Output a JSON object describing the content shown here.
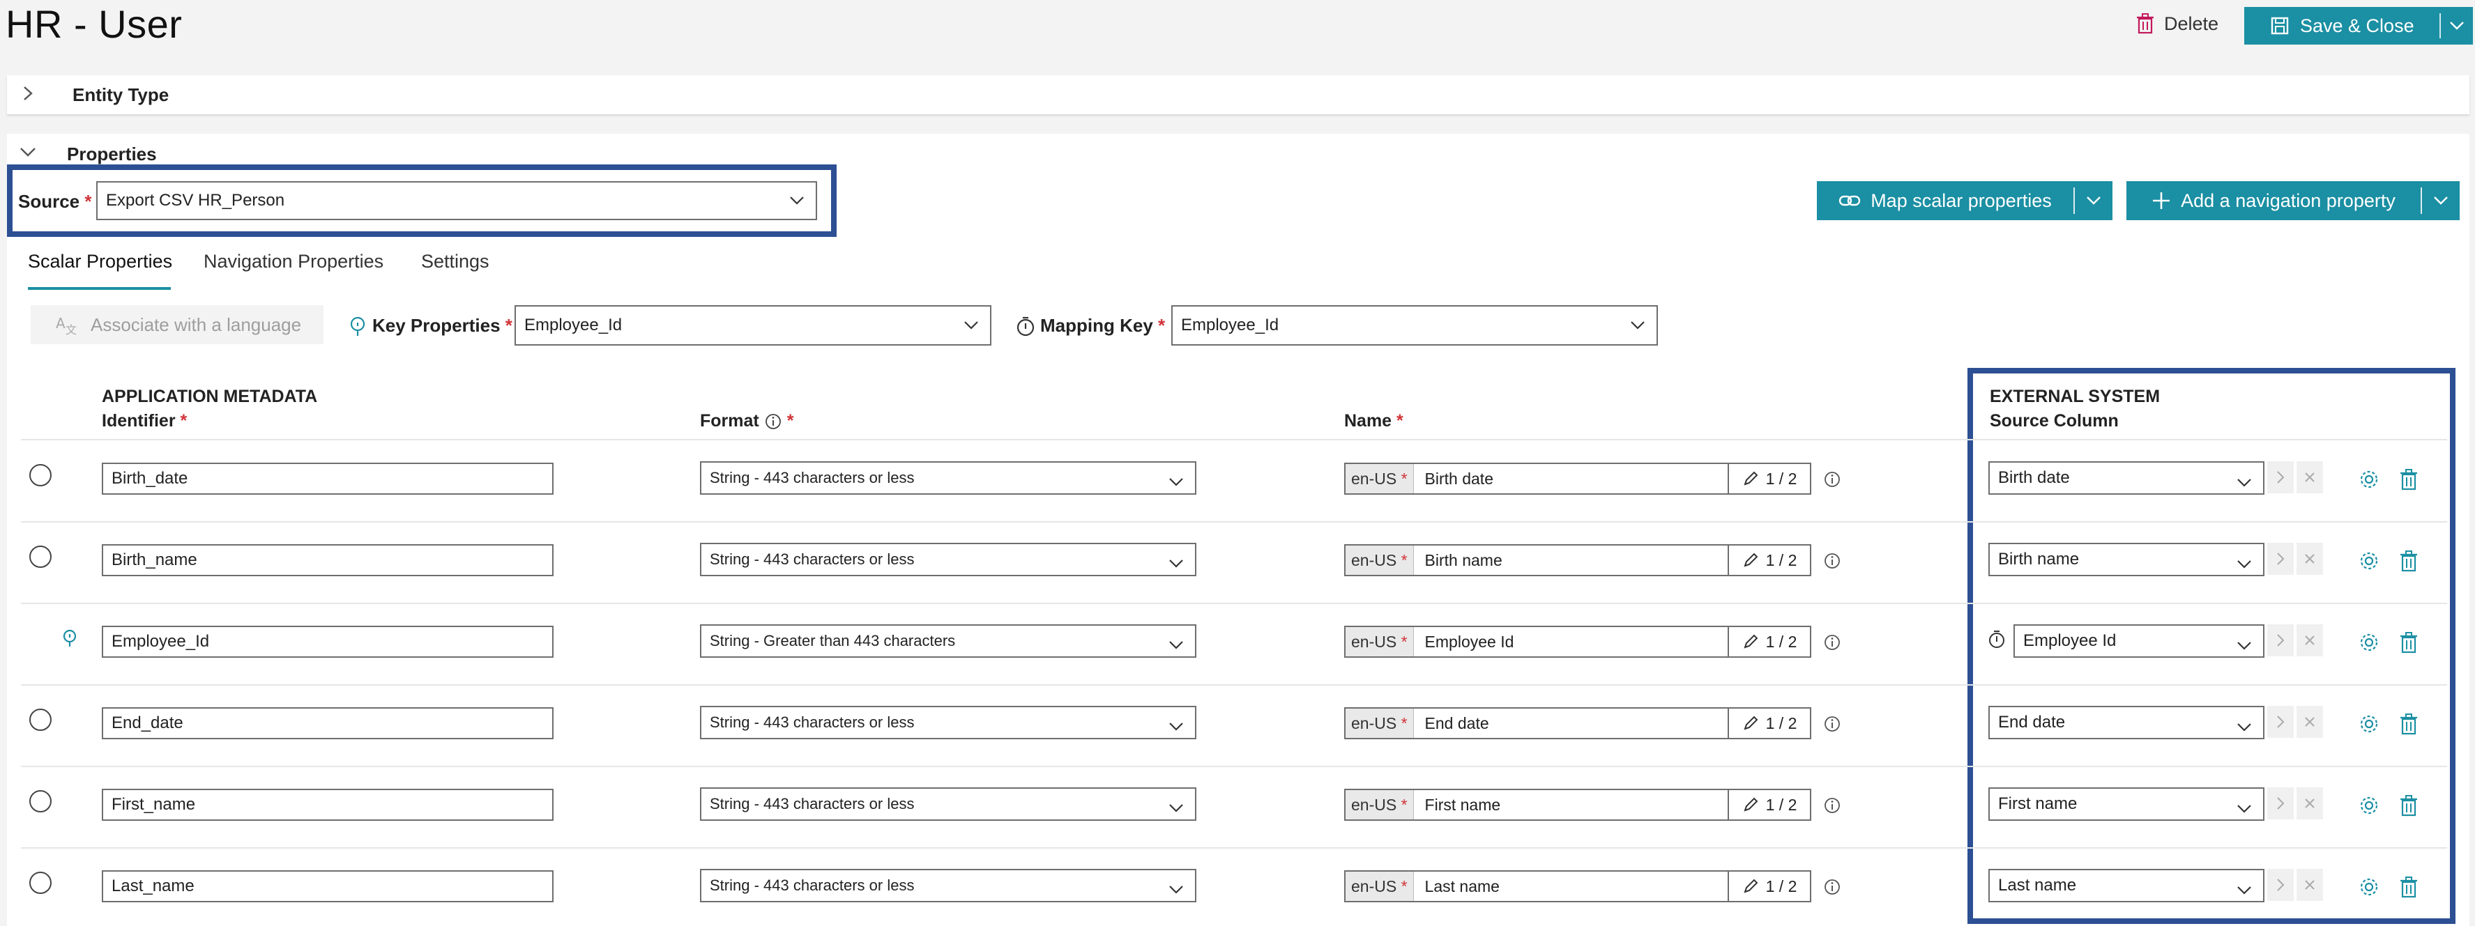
{
  "header": {
    "title": "HR - User",
    "delete_label": "Delete",
    "save_label": "Save & Close"
  },
  "sections": {
    "entity_type": "Entity Type",
    "properties": "Properties"
  },
  "source": {
    "label": "Source",
    "value": "Export CSV HR_Person"
  },
  "actions": {
    "map_scalar": "Map scalar properties",
    "add_navigation": "Add a navigation property"
  },
  "tabs": [
    "Scalar Properties",
    "Navigation Properties",
    "Settings"
  ],
  "toolbar": {
    "associate": "Associate with a language",
    "key_properties_label": "Key Properties",
    "key_properties_value": "Employee_Id",
    "mapping_key_label": "Mapping Key",
    "mapping_key_value": "Employee_Id"
  },
  "columns": {
    "app_metadata": "APPLICATION METADATA",
    "identifier": "Identifier",
    "format": "Format",
    "name": "Name",
    "external_system": "EXTERNAL SYSTEM",
    "source_column": "Source Column"
  },
  "rows": [
    {
      "identifier": "Birth_date",
      "format": "String - 443 characters or less",
      "lang": "en-US",
      "name": "Birth date",
      "count": "1 / 2",
      "source": "Birth date",
      "is_key": false
    },
    {
      "identifier": "Birth_name",
      "format": "String - 443 characters or less",
      "lang": "en-US",
      "name": "Birth name",
      "count": "1 / 2",
      "source": "Birth name",
      "is_key": false
    },
    {
      "identifier": "Employee_Id",
      "format": "String - Greater than 443 characters",
      "lang": "en-US",
      "name": "Employee Id",
      "count": "1 / 2",
      "source": "Employee Id",
      "is_key": true
    },
    {
      "identifier": "End_date",
      "format": "String - 443 characters or less",
      "lang": "en-US",
      "name": "End date",
      "count": "1 / 2",
      "source": "End date",
      "is_key": false
    },
    {
      "identifier": "First_name",
      "format": "String - 443 characters or less",
      "lang": "en-US",
      "name": "First name",
      "count": "1 / 2",
      "source": "First name",
      "is_key": false
    },
    {
      "identifier": "Last_name",
      "format": "String - 443 characters or less",
      "lang": "en-US",
      "name": "Last name",
      "count": "1 / 2",
      "source": "Last name",
      "is_key": false
    }
  ],
  "colors": {
    "accent": "#1b8fa3",
    "highlight_border": "#2d4f93",
    "required": "#d13438"
  }
}
